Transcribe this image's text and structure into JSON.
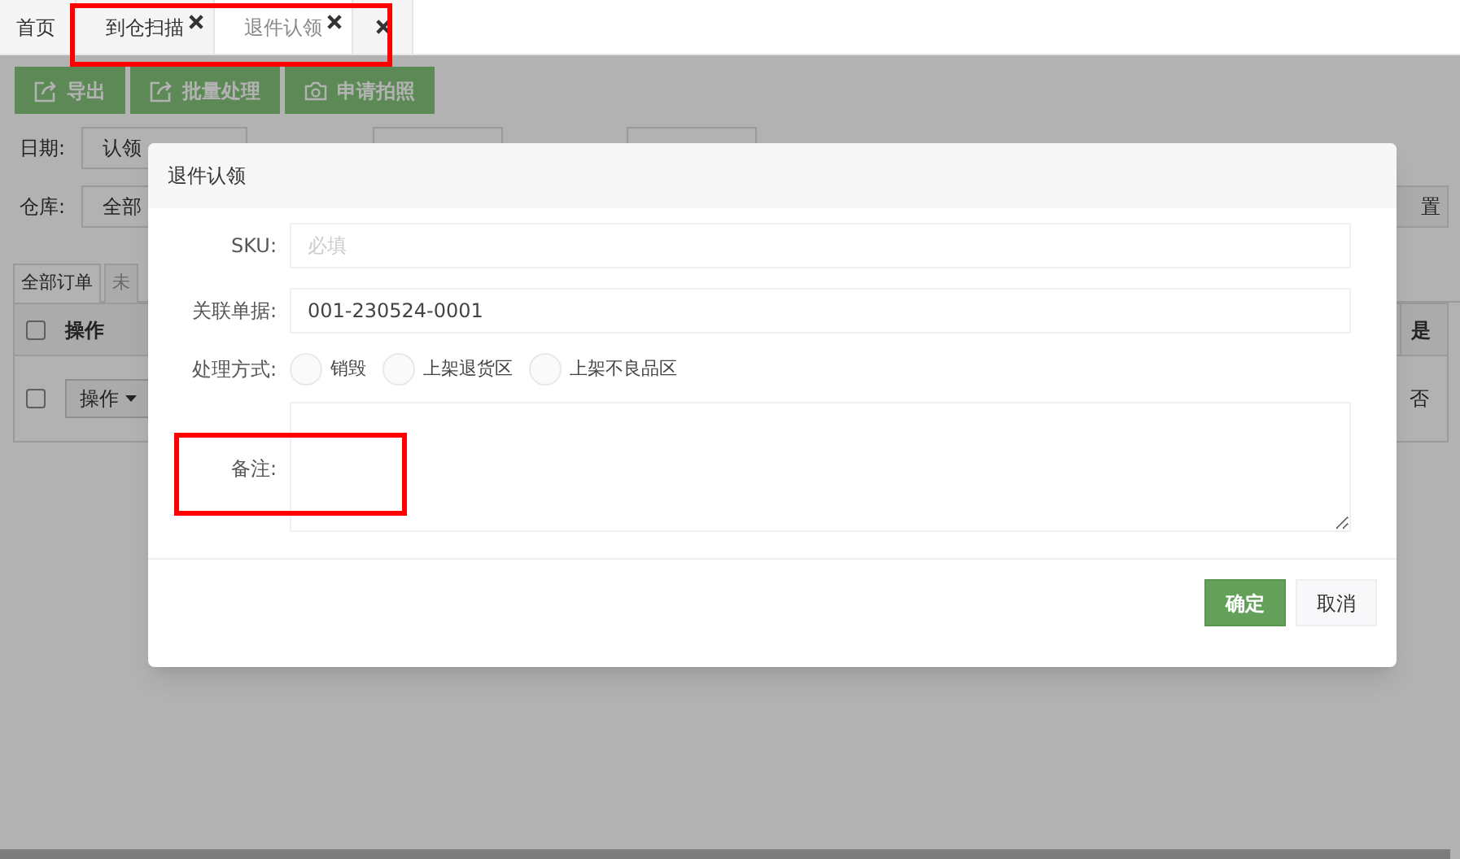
{
  "tabs": [
    {
      "label": "首页",
      "closable": false,
      "selected": false
    },
    {
      "label": "到仓扫描",
      "closable": true,
      "selected": false
    },
    {
      "label": "退件认领",
      "closable": true,
      "selected": true
    }
  ],
  "toolbar": [
    {
      "label": "导出",
      "kind": "export"
    },
    {
      "label": "批量处理",
      "kind": "export"
    },
    {
      "label": "申请拍照",
      "kind": "camera"
    }
  ],
  "filters": {
    "date_label": "日期:",
    "date_select": "认领",
    "warehouse_label": "仓库:",
    "warehouse_select": "全部",
    "reset_button": "置"
  },
  "order_tabs": [
    {
      "label": "全部订单",
      "selected": true
    },
    {
      "label": "未",
      "selected": false
    }
  ],
  "table": {
    "columns": [
      "操作",
      "是"
    ],
    "header_checked": false,
    "rows": [
      {
        "checked": false,
        "action": "操作",
        "column_2": "否"
      }
    ]
  },
  "modal": {
    "title": "退件认领",
    "sku": {
      "label": "SKU:",
      "placeholder": "必填"
    },
    "reference": {
      "label": "关联单据:",
      "value": "001-230524-0001"
    },
    "method": {
      "label": "处理方式:",
      "options": [
        {
          "label": "销毁",
          "selected": false
        },
        {
          "label": "上架退货区",
          "selected": false
        },
        {
          "label": "上架不良品区",
          "selected": false
        }
      ]
    },
    "note": {
      "label": "备注:"
    },
    "buttons": [
      {
        "label": "确定",
        "kind": "primary"
      },
      {
        "label": "取消",
        "kind": "default"
      }
    ]
  }
}
